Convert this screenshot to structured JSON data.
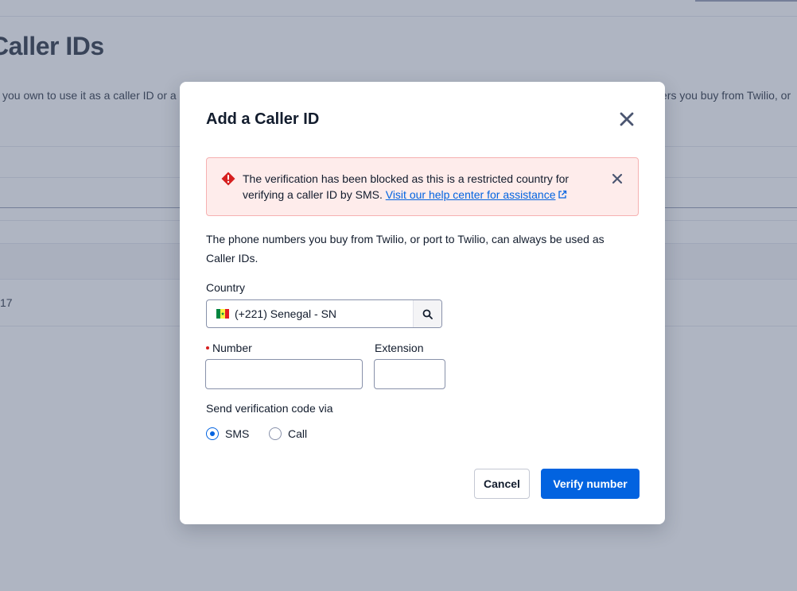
{
  "background": {
    "title": "Caller IDs",
    "desc_left": "you own to use it as a caller ID or a",
    "desc_right": "ers you buy from Twilio, or",
    "cell_value": "17"
  },
  "modal": {
    "title": "Add a Caller ID",
    "alert": {
      "message": "The verification has been blocked as this is a restricted country for verifying a caller ID by SMS.",
      "link_text": "Visit our help center for assistance"
    },
    "description": "The phone numbers you buy from Twilio, or port to Twilio, can always be used as Caller IDs.",
    "country": {
      "label": "Country",
      "value": "(+221) Senegal - SN",
      "flag_icon": "senegal-flag-icon"
    },
    "number": {
      "label": "Number",
      "value": "",
      "required": true
    },
    "extension": {
      "label": "Extension",
      "value": ""
    },
    "send_via": {
      "label": "Send verification code via",
      "options": [
        "SMS",
        "Call"
      ],
      "selected": "SMS"
    },
    "buttons": {
      "cancel": "Cancel",
      "verify": "Verify number"
    }
  },
  "colors": {
    "primary": "#0263e0",
    "error_bg": "#feeceb",
    "error_icon": "#d61f1f",
    "text": "#121c2d"
  }
}
